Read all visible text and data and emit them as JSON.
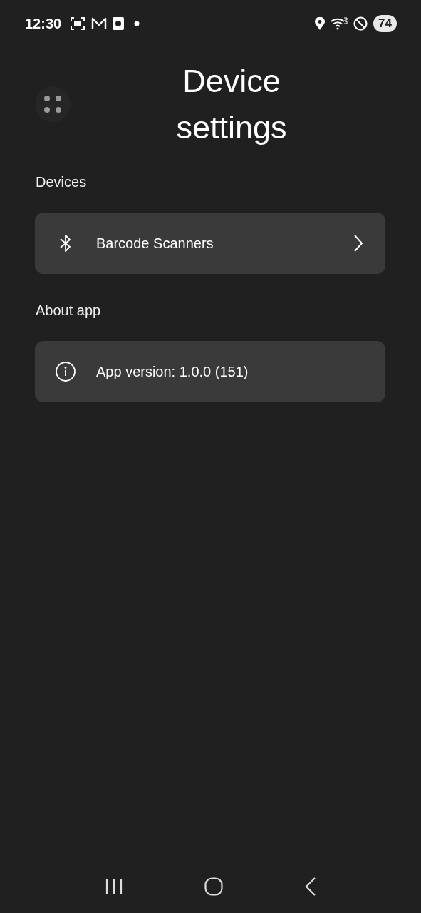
{
  "status_bar": {
    "time": "12:30",
    "battery": "74"
  },
  "title": "Device settings",
  "sections": [
    {
      "label": "Devices",
      "items": [
        {
          "kind": "link",
          "label": "Barcode Scanners"
        }
      ]
    },
    {
      "label": "About app",
      "items": [
        {
          "kind": "info",
          "label": "App version: 1.0.0 (151)"
        }
      ]
    }
  ]
}
